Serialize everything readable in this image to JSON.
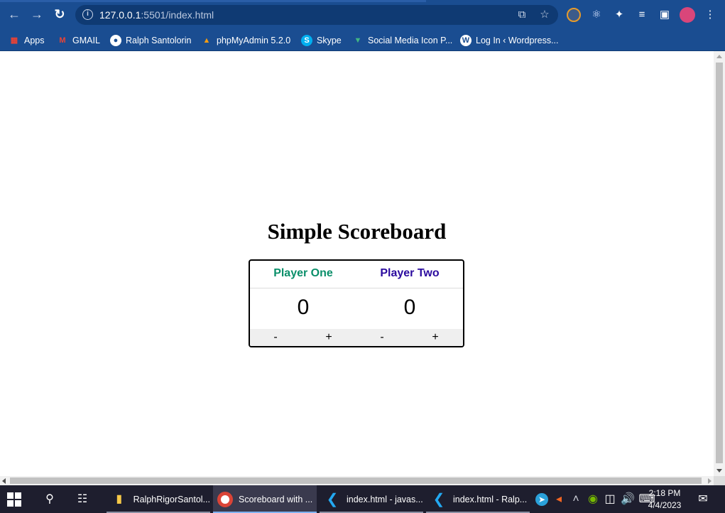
{
  "browser": {
    "url_host": "127.0.0.1",
    "url_rest": ":5501/index.html",
    "icons": {
      "back": "arrow-left-icon",
      "forward": "arrow-right-icon",
      "reload": "reload-icon",
      "site_info": "info-icon",
      "share": "share-icon",
      "bookmark": "star-icon",
      "extensions": "puzzle-icon",
      "menu": "kebab-menu-icon"
    }
  },
  "bookmarks": [
    {
      "label": "Apps",
      "icon": "apps-grid-icon"
    },
    {
      "label": "GMAIL",
      "icon": "gmail-icon"
    },
    {
      "label": "Ralph Santolorin",
      "icon": "globe-icon"
    },
    {
      "label": "phpMyAdmin 5.2.0",
      "icon": "phpmyadmin-icon"
    },
    {
      "label": "Skype",
      "icon": "skype-icon"
    },
    {
      "label": "Social Media Icon P...",
      "icon": "vue-icon"
    },
    {
      "label": "Log In ‹ Wordpress...",
      "icon": "wordpress-icon"
    }
  ],
  "page": {
    "title": "Simple Scoreboard",
    "players": [
      {
        "name": "Player One",
        "score": "0",
        "color": "#0a8f6a",
        "minus": "-",
        "plus": "+"
      },
      {
        "name": "Player Two",
        "score": "0",
        "color": "#2a0a9e",
        "minus": "-",
        "plus": "+"
      }
    ]
  },
  "taskbar": {
    "apps": [
      {
        "label": "RalphRigorSantol...",
        "icon": "folder-icon"
      },
      {
        "label": "Scoreboard with ...",
        "icon": "chrome-icon"
      },
      {
        "label": "index.html - javas...",
        "icon": "vscode-icon"
      },
      {
        "label": "index.html - Ralp...",
        "icon": "vscode-icon"
      }
    ],
    "time": "2:18 PM",
    "date": "4/4/2023"
  }
}
